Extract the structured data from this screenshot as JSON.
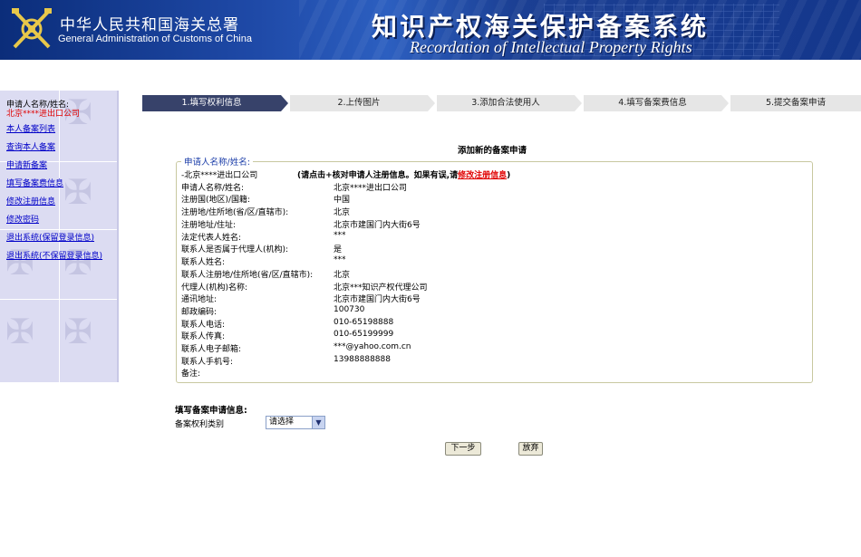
{
  "header": {
    "org_cn": "中华人民共和国海关总署",
    "org_en": "General Administration of Customs of China",
    "system_cn": "知识产权海关保护备案系统",
    "system_en": "Recordation of Intellectual Property Rights",
    "colors": {
      "banner": "#1f4aa8",
      "banner_dark": "#0b2d7a"
    }
  },
  "sidebar": {
    "user_label": "申请人名称/姓名:",
    "user_name": "北京****进出口公司",
    "items": [
      {
        "label": "本人备案列表"
      },
      {
        "label": "查询本人备案"
      },
      {
        "label": "申请新备案"
      },
      {
        "label": "填写备案费信息"
      },
      {
        "label": "修改注册信息"
      },
      {
        "label": "修改密码"
      },
      {
        "label": "退出系统(保留登录信息)"
      },
      {
        "label": "退出系统(不保留登录信息)"
      }
    ],
    "colors": {
      "background": "#dcdcf2",
      "link": "#0000c8",
      "user_name": "#e00000"
    }
  },
  "steps": [
    {
      "label": "1.填写权利信息",
      "active": true
    },
    {
      "label": "2.上传图片",
      "active": false
    },
    {
      "label": "3.添加合法使用人",
      "active": false
    },
    {
      "label": "4.填写备案费信息",
      "active": false
    },
    {
      "label": "5.提交备案申请",
      "active": false
    }
  ],
  "main": {
    "title": "添加新的备案申请",
    "applicant": {
      "legend": "申请人名称/姓名:",
      "summary": "北京****进出口公司",
      "note_prefix": "(请点击+核对申请人注册信息。如果有误,请",
      "note_link": "修改注册信息",
      "note_suffix": ")",
      "fields": [
        {
          "label": "申请人名称/姓名:",
          "value": "北京****进出口公司"
        },
        {
          "label": "注册国(地区)/国籍:",
          "value": "中国"
        },
        {
          "label": "注册地/住所地(省/区/直辖市):",
          "value": "北京"
        },
        {
          "label": "注册地址/住址:",
          "value": "北京市建国门内大街6号"
        },
        {
          "label": "法定代表人姓名:",
          "value": "***"
        },
        {
          "label": "联系人是否属于代理人(机构):",
          "value": "是"
        },
        {
          "label": "联系人姓名:",
          "value": "***"
        },
        {
          "label": "联系人注册地/住所地(省/区/直辖市):",
          "value": "北京"
        },
        {
          "label": "代理人(机构)名称:",
          "value": "北京***知识产权代理公司"
        },
        {
          "label": "通讯地址:",
          "value": "北京市建国门内大街6号"
        },
        {
          "label": "邮政编码:",
          "value": "100730"
        },
        {
          "label": "联系人电话:",
          "value": "010-65198888"
        },
        {
          "label": "联系人传真:",
          "value": "010-65199999"
        },
        {
          "label": "联系人电子邮箱:",
          "value": "***@yahoo.com.cn"
        },
        {
          "label": "联系人手机号:",
          "value": "13988888888"
        },
        {
          "label": "备注:",
          "value": ""
        }
      ]
    },
    "form": {
      "heading": "填写备案申请信息:",
      "type_label": "备案权利类别",
      "type_selected": "请选择",
      "next_button": "下一步",
      "cancel_button": "放弃"
    },
    "colors": {
      "step_active": "#37426a",
      "step_inactive": "#e6e6e6",
      "legend": "#1a3ca8",
      "link_red": "#e00000"
    }
  }
}
